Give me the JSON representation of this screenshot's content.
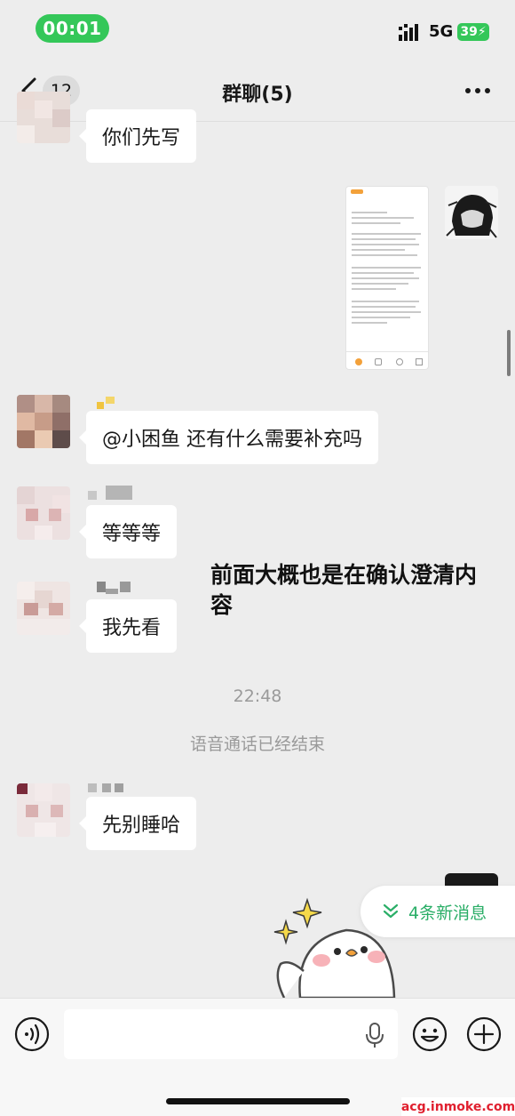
{
  "status_bar": {
    "time": "00:01",
    "network": "5G",
    "battery": "39"
  },
  "nav": {
    "unread_count": "12",
    "title": "群聊(5)"
  },
  "messages": [
    {
      "type": "text",
      "side": "left",
      "text": "你们先写"
    },
    {
      "type": "image",
      "side": "right"
    },
    {
      "type": "text",
      "side": "left",
      "text": "@小困鱼 还有什么需要补充吗"
    },
    {
      "type": "text",
      "side": "left",
      "text": "等等等"
    },
    {
      "type": "text",
      "side": "left",
      "text": "我先看"
    },
    {
      "type": "time",
      "text": "22:48"
    },
    {
      "type": "system",
      "text": "语音通话已经结束"
    },
    {
      "type": "text",
      "side": "left",
      "text": "先别睡哈"
    },
    {
      "type": "sticker",
      "side": "right"
    }
  ],
  "annotation": "前面大概也是在确认澄清内容",
  "new_messages_pill": "4条新消息",
  "watermark": "acg.inmoke.com",
  "colors": {
    "accent_green": "#34c759",
    "wechat_green": "#2aae67",
    "chat_bg": "#ededed",
    "bubble": "#ffffff"
  },
  "icons": {
    "back": "chevron-left-icon",
    "more": "more-dots-icon",
    "voice": "voice-input-icon",
    "mic": "mic-icon",
    "emoji": "emoji-icon",
    "plus": "plus-icon",
    "new_messages": "double-chevron-down-icon"
  }
}
